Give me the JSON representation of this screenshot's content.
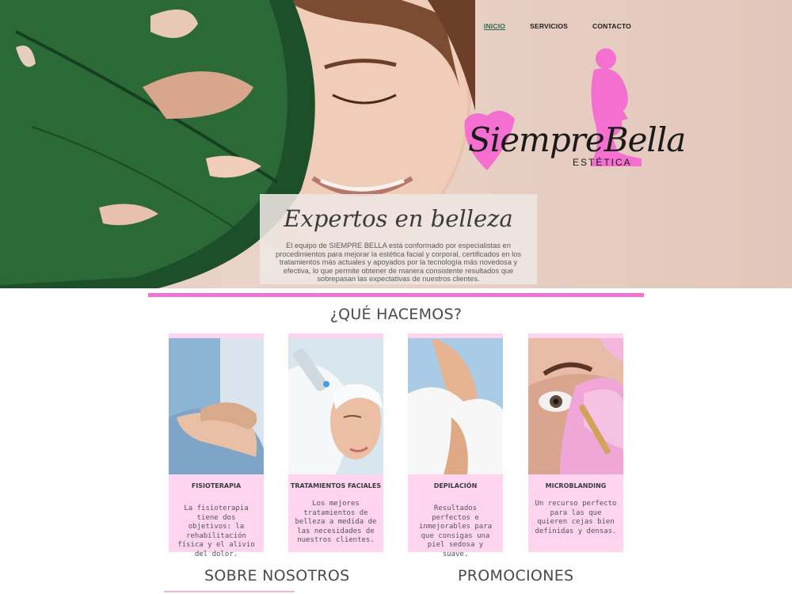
{
  "nav": {
    "items": [
      {
        "label": "INICIO",
        "active": true
      },
      {
        "label": "SERVICIOS",
        "active": false
      },
      {
        "label": "CONTACTO",
        "active": false
      }
    ]
  },
  "logo": {
    "script": "SiempreBella",
    "sub": "ESTÉTICA"
  },
  "hero": {
    "title": "Expertos en belleza",
    "description": "El equipo de SIEMPRE BELLA está conformado por especialistas en procedimientos para mejorar la estética facial y corporal, certificados en los tratamientos más actuales y apoyados por la tecnología más novedosa y efectiva, lo que permite obtener de manera consistente resultados que sobrepasan las expectativas de nuestros clientes."
  },
  "services": {
    "heading": "¿QUÉ HACEMOS?",
    "cards": [
      {
        "title": "FISIOTERAPIA",
        "description": "La fisioterapia tiene dos objetivos: la rehabilitación física y el alivio del dolor.",
        "icon": "massage-photo"
      },
      {
        "title": "TRATAMIENTOS FACIALES",
        "description": "Los mejores tratamientos de belleza a medida de las necesidades de nuestros clientes.",
        "icon": "facial-photo"
      },
      {
        "title": "DEPILACIÓN",
        "description": "Resultados perfectos e inmejorables para que consigas una piel sedosa y suave.",
        "icon": "waxing-photo"
      },
      {
        "title": "MICROBLANDING",
        "description": "Un recurso perfecto para las que quieren cejas bien definidas y densas.",
        "icon": "eyebrow-photo"
      }
    ]
  },
  "bottom": {
    "about": "SOBRE NOSOTROS",
    "promos": "PROMOCIONES"
  },
  "colors": {
    "accent_pink": "#f074cf",
    "card_bg": "#ffd4ef",
    "nav_active": "#2d6a4f"
  }
}
